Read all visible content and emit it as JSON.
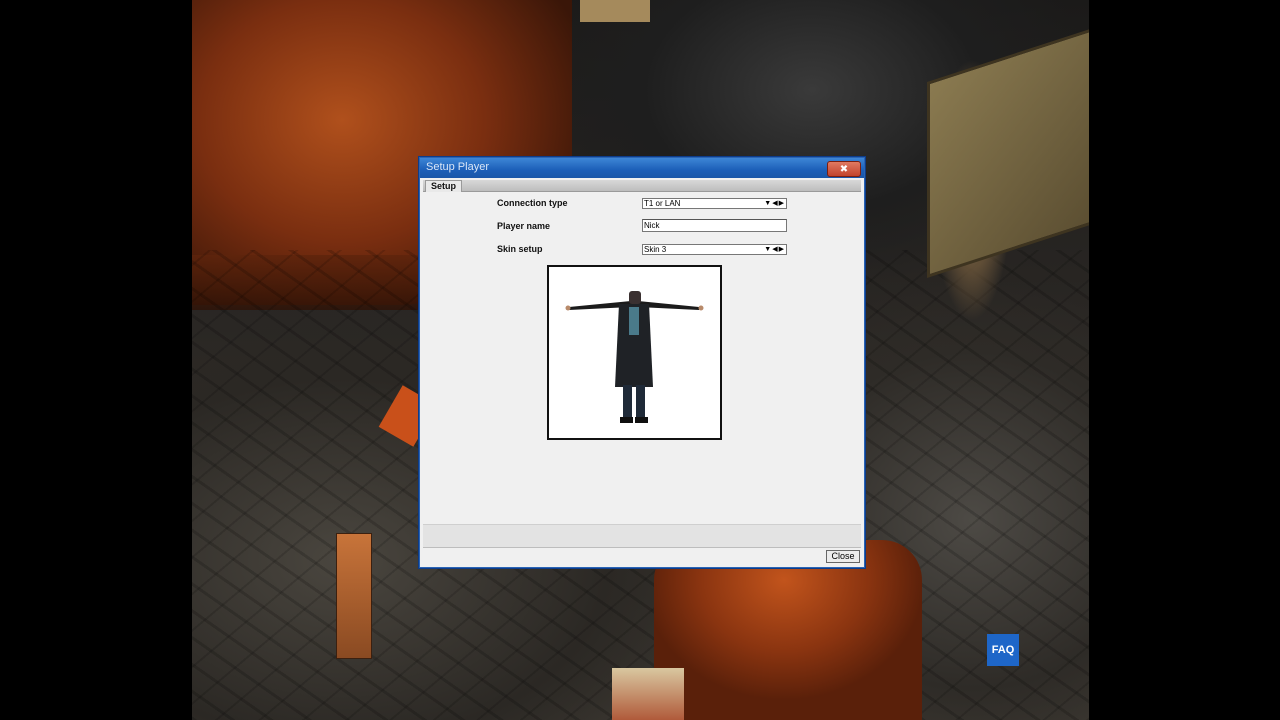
{
  "window": {
    "title": "Setup Player",
    "close_glyph": "✖"
  },
  "tabs": [
    {
      "label": "Setup",
      "active": true
    }
  ],
  "form": {
    "connection_type": {
      "label": "Connection type",
      "value": "T1 or LAN"
    },
    "player_name": {
      "label": "Player name",
      "value": "Nick"
    },
    "skin_setup": {
      "label": "Skin setup",
      "value": "Skin 3"
    }
  },
  "arrows": {
    "down": "▼",
    "left": "◀",
    "right": "▶"
  },
  "footer": {
    "close_label": "Close"
  },
  "overlay": {
    "faq_label": "FAQ"
  },
  "colors": {
    "titlebar": "#1c5fb8",
    "dialog_bg": "#f0f0f0",
    "faq_badge": "#1e66c8"
  }
}
